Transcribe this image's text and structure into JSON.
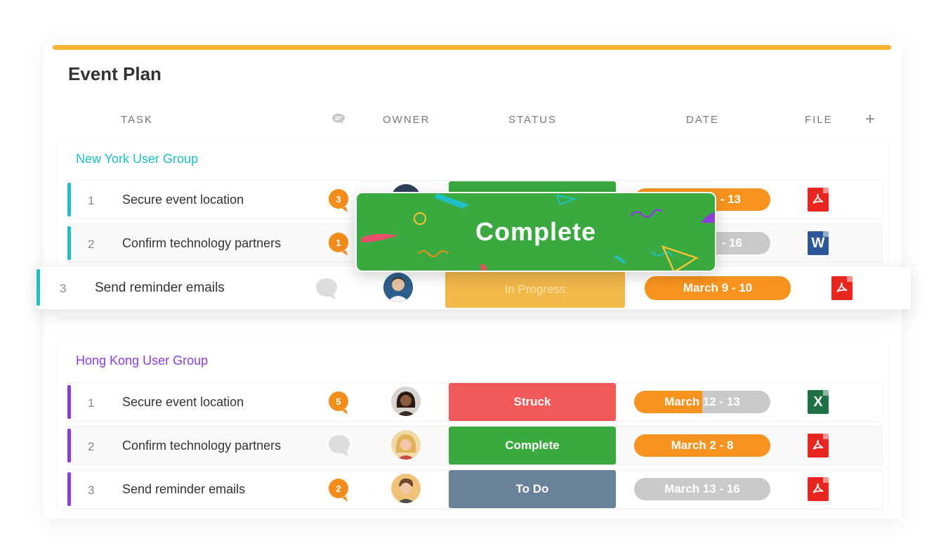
{
  "title": "Event Plan",
  "columns": {
    "task": "TASK",
    "owner": "OWNER",
    "status": "STATUS",
    "date": "DATE",
    "file": "FILE",
    "add": "+"
  },
  "groups": [
    {
      "name": "New York User Group",
      "color": "#1fbfc4",
      "rows": [
        {
          "num": "1",
          "task": "Secure event location",
          "comments": "3",
          "status": "",
          "date": "- 13",
          "file": "pdf"
        },
        {
          "num": "2",
          "task": "Confirm technology partners",
          "comments": "1",
          "status": "",
          "date": "- 16",
          "file": "word"
        }
      ]
    },
    {
      "name": "Hong Kong User Group",
      "color": "#8a3fd9",
      "rows": [
        {
          "num": "1",
          "task": "Secure event location",
          "comments": "5",
          "status": "Struck",
          "status_color": "#f25a5a",
          "date": "March 12 - 13",
          "date_progress": 0.5,
          "file": "excel"
        },
        {
          "num": "2",
          "task": "Confirm technology partners",
          "comments": "",
          "status": "Complete",
          "status_color": "#3aaa40",
          "date": "March 2 - 8",
          "date_progress": 1.0,
          "file": "pdf"
        },
        {
          "num": "3",
          "task": "Send reminder emails",
          "comments": "2",
          "status": "To Do",
          "status_color": "#6a819a",
          "date": "March 13 - 16",
          "date_progress": 0.0,
          "file": "pdf"
        }
      ]
    }
  ],
  "dragged_row": {
    "num": "3",
    "task": "Send reminder emails",
    "status": "In Progress",
    "status_color": "#f1b84a",
    "date": "March 9 - 10",
    "date_progress": 1.0,
    "file": "pdf"
  },
  "popup": {
    "label": "Complete"
  },
  "icons": {
    "word": "W",
    "excel": "X"
  },
  "colors": {
    "accent": "#f9b233",
    "orange": "#f7931e",
    "pdf": "#e8251f",
    "word": "#2b5797",
    "excel": "#1e7145"
  }
}
